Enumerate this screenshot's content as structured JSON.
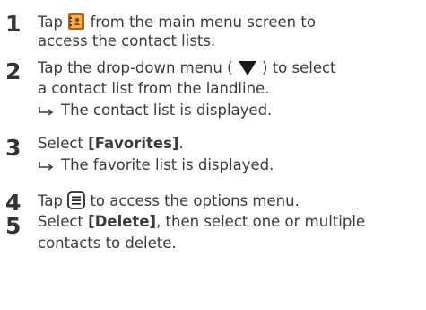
{
  "steps": [
    {
      "number": "1",
      "line1_before": "Tap",
      "line1_after": "from the main menu screen to",
      "line2": "access the contact lists."
    },
    {
      "number": "2",
      "line1_before": "Tap the drop-down menu (",
      "line1_after": ") to select",
      "line2": "a contact list from the landline.",
      "result": "The contact list is displayed."
    },
    {
      "number": "3",
      "line1_before": "Select",
      "line1_bold": "[Favorites]",
      "line1_after": ".",
      "result": "The favorite list is displayed."
    },
    {
      "number": "4",
      "line1_before": "Tap",
      "line1_after": "to access the options menu."
    },
    {
      "number": "5",
      "line1_before": "Select",
      "line1_bold": "[Delete]",
      "line1_after": ", then select one or multiple",
      "line2": "contacts to delete."
    }
  ],
  "icons": {
    "phonebook": "phonebook-icon",
    "dropdown": "dropdown-triangle-icon",
    "options": "options-menu-icon",
    "result_arrow": "result-arrow-icon"
  },
  "colors": {
    "text": "#3b3b3b",
    "phonebook_brown": "#b5651d",
    "phonebook_gold": "#f0b24a"
  }
}
